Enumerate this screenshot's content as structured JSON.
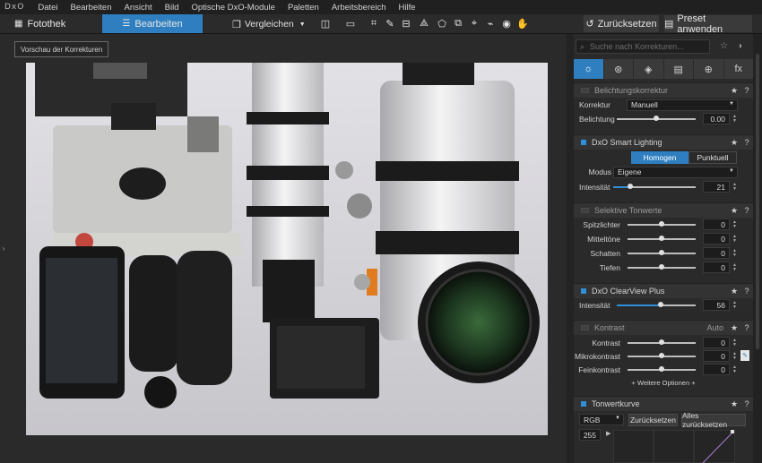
{
  "app": {
    "logo": "DxO"
  },
  "menu": [
    "Datei",
    "Bearbeiten",
    "Ansicht",
    "Bild",
    "Optische DxO-Module",
    "Paletten",
    "Arbeitsbereich",
    "Hilfe"
  ],
  "toolbar": {
    "tab_fotothek": "Fotothek",
    "tab_bearbeiten": "Bearbeiten",
    "vergleichen": "Vergleichen",
    "reset": "Zurücksetzen",
    "preset": "Preset anwenden",
    "tools": [
      "split-view-icon",
      "frame-icon",
      "crop-icon",
      "white-balance-picker-icon",
      "auto-horizon-icon",
      "perspective-icon",
      "volume-deformation-icon",
      "repair-icon",
      "red-eye-icon",
      "local-adjustments-icon",
      "visibility-icon",
      "hand-tool-icon"
    ]
  },
  "viewer": {
    "preview_label": "Vorschau der Korrekturen"
  },
  "panel": {
    "search_placeholder": "Suche nach Korrekturen...",
    "tabs": [
      "light-icon",
      "color-icon",
      "detail-icon",
      "geometry-icon",
      "local-icon",
      "fx-icon"
    ],
    "fx_label": "fx",
    "exposure": {
      "title": "Belichtungskorrektur",
      "korrektur_label": "Korrektur",
      "korrektur_value": "Manuell",
      "belichtung_label": "Belichtung",
      "belichtung_value": "0.00",
      "belichtung_pos": 0.5
    },
    "smart_lighting": {
      "title": "DxO Smart Lighting",
      "mode_homogen": "Homogen",
      "mode_punktuell": "Punktuell",
      "modus_label": "Modus",
      "modus_value": "Eigene",
      "intensitaet_label": "Intensität",
      "intensitaet_value": "21",
      "intensitaet_pos": 0.21
    },
    "selective_tones": {
      "title": "Selektive Tonwerte",
      "rows": [
        {
          "label": "Spitzlichter",
          "value": "0",
          "pos": 0.5
        },
        {
          "label": "Mitteltöne",
          "value": "0",
          "pos": 0.5
        },
        {
          "label": "Schatten",
          "value": "0",
          "pos": 0.5
        },
        {
          "label": "Tiefen",
          "value": "0",
          "pos": 0.5
        }
      ]
    },
    "clearview": {
      "title": "DxO ClearView Plus",
      "intensitaet_label": "Intensität",
      "intensitaet_value": "56",
      "intensitaet_pos": 0.56
    },
    "contrast": {
      "title": "Kontrast",
      "auto": "Auto",
      "rows": [
        {
          "label": "Kontrast",
          "value": "0",
          "pos": 0.5
        },
        {
          "label": "Mikrokontrast",
          "value": "0",
          "pos": 0.5
        },
        {
          "label": "Feinkontrast",
          "value": "0",
          "pos": 0.5
        }
      ],
      "more": "+ Weitere Optionen +"
    },
    "tone_curve": {
      "title": "Tonwertkurve",
      "channel": "RGB",
      "reset": "Zurücksetzen",
      "reset_all": "Alles zurücksetzen",
      "level": "255"
    }
  },
  "colors": {
    "accent": "#2f7fc0",
    "panel_bg": "#2a2a2a",
    "section_header": "#333333"
  }
}
